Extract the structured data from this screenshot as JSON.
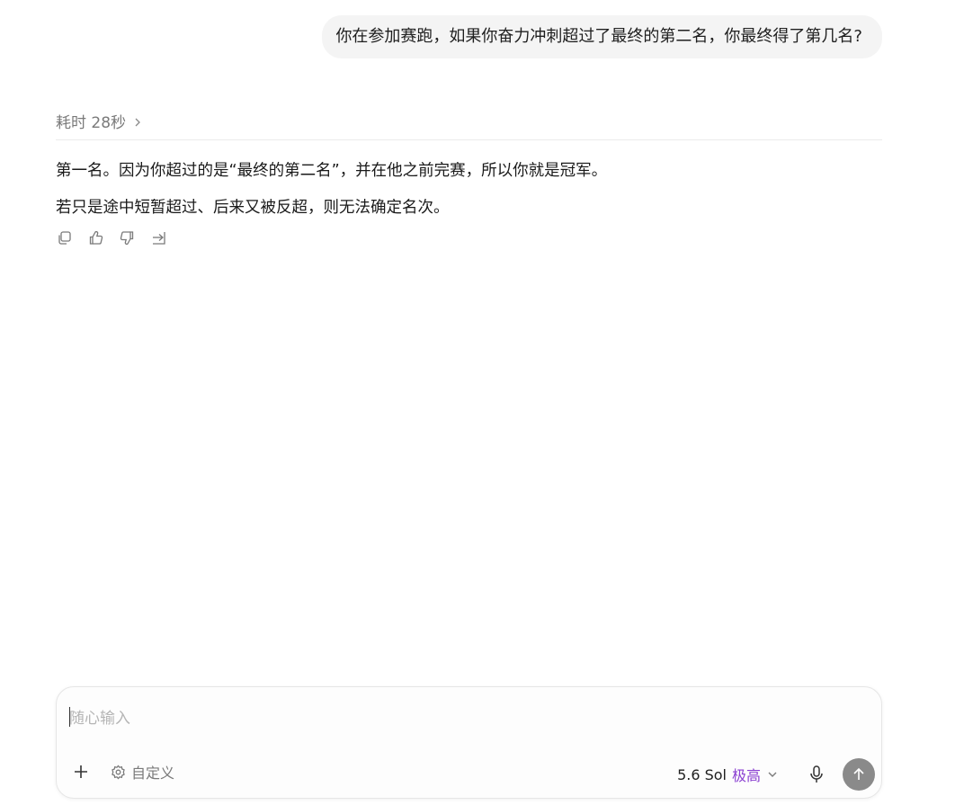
{
  "conversation": {
    "user_message": "你在参加赛跑，如果你奋力冲刺超过了最终的第二名，你最终得了第几名?",
    "thinking_label": "耗时 28秒",
    "answer_paragraphs": [
      "第一名。因为你超过的是“最终的第二名”，并在他之前完赛，所以你就是冠军。",
      "若只是途中短暂超过、后来又被反超，则无法确定名次。"
    ],
    "actions": [
      "copy-icon",
      "thumbs-up-icon",
      "thumbs-down-icon",
      "share-icon"
    ]
  },
  "composer": {
    "placeholder": "随心输入",
    "custom_label": "自定义",
    "model_name": "5.6 Sol",
    "model_level": "极高",
    "model_level_color": "#8a3fd1",
    "send_button_color": "#8a8a8a"
  }
}
